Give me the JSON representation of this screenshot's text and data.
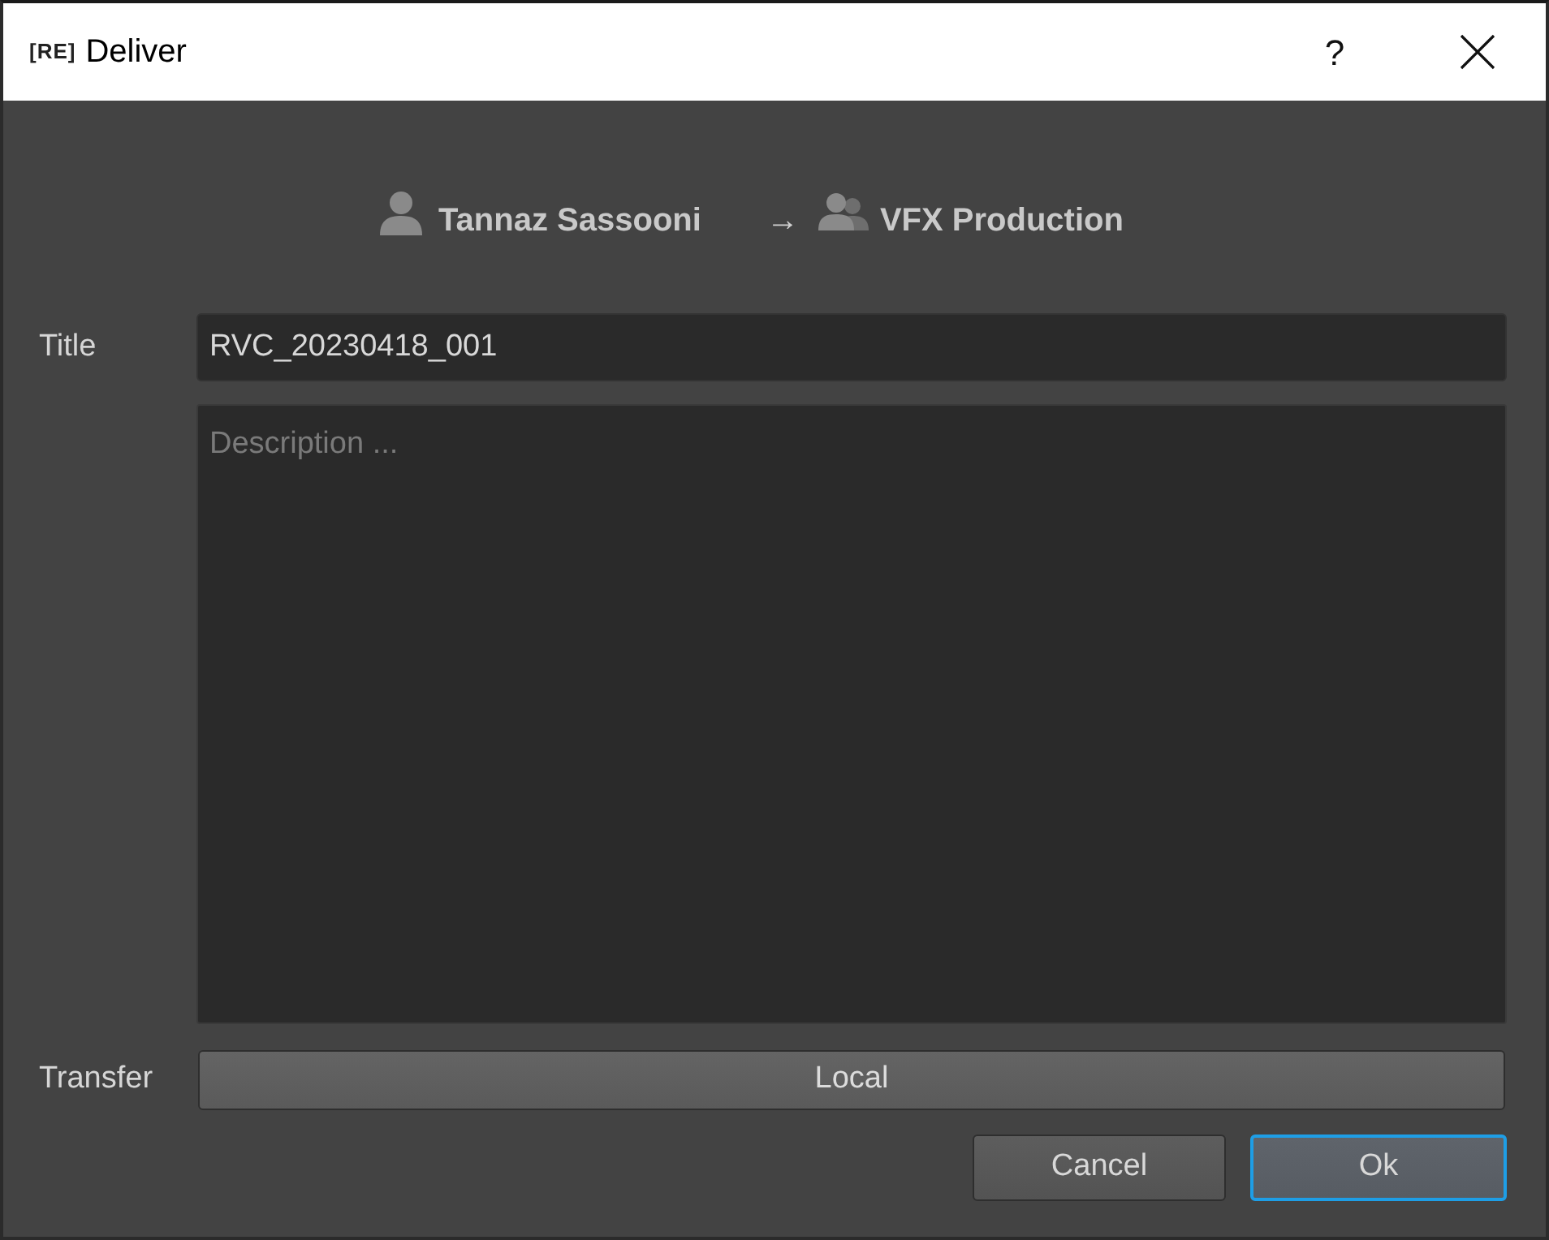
{
  "window": {
    "logo": "[RE]",
    "title": "Deliver",
    "help": "?"
  },
  "route": {
    "sender": "Tannaz Sassooni",
    "arrow": "→",
    "recipient": "VFX Production"
  },
  "form": {
    "title_label": "Title",
    "title_value": "RVC_20230418_001",
    "description_placeholder": "Description ...",
    "transfer_label": "Transfer",
    "transfer_value": "Local"
  },
  "buttons": [
    {
      "label": "Cancel",
      "focused": false
    },
    {
      "label": "Ok",
      "focused": true
    }
  ]
}
